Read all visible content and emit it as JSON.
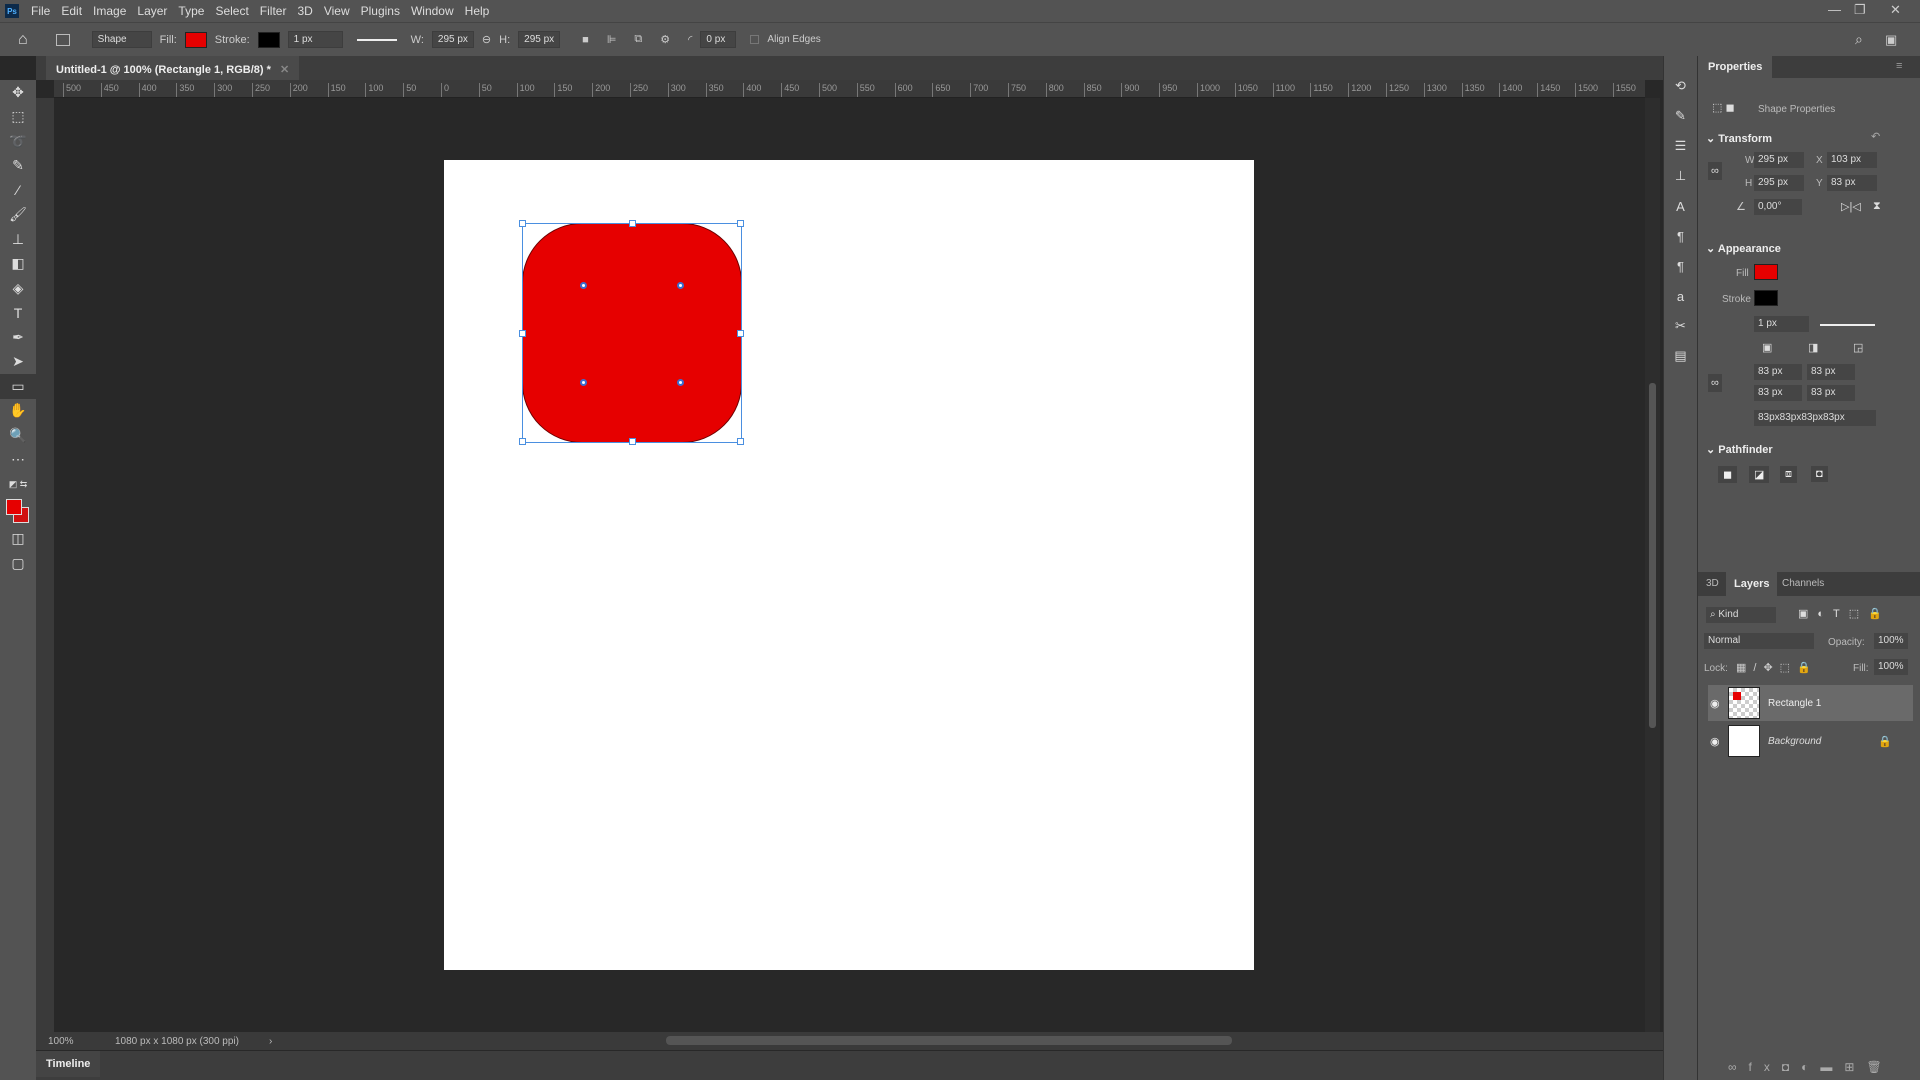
{
  "app": {
    "logo": "Ps",
    "menu": [
      "File",
      "Edit",
      "Image",
      "Layer",
      "Type",
      "Select",
      "Filter",
      "3D",
      "View",
      "Plugins",
      "Window",
      "Help"
    ]
  },
  "options": {
    "mode": "Shape",
    "fill_label": "Fill:",
    "stroke_label": "Stroke:",
    "stroke_width": "1 px",
    "w_label": "W:",
    "w_value": "295 px",
    "h_label": "H:",
    "h_value": "295 px",
    "radius": "0 px",
    "align_edges": "Align Edges",
    "fill_color": "#e60000"
  },
  "document": {
    "tab_title": "Untitled-1 @ 100% (Rectangle 1, RGB/8) *",
    "zoom": "100%",
    "doc_info": "1080 px x 1080 px (300 ppi)"
  },
  "ruler": [
    "500",
    "450",
    "400",
    "350",
    "300",
    "250",
    "200",
    "150",
    "100",
    "50",
    "0",
    "50",
    "100",
    "150",
    "200",
    "250",
    "300",
    "350",
    "400",
    "450",
    "500",
    "550",
    "600",
    "650",
    "700",
    "750",
    "800",
    "850",
    "900",
    "950",
    "1000",
    "1050",
    "1100",
    "1150",
    "1200",
    "1250",
    "1300",
    "1350",
    "1400",
    "1450",
    "1500",
    "1550"
  ],
  "timeline": "Timeline",
  "properties": {
    "title": "Properties",
    "subtitle": "Shape Properties",
    "transform": {
      "title": "Transform",
      "w_label": "W",
      "w": "295 px",
      "h_label": "H",
      "h": "295 px",
      "x_label": "X",
      "x": "103 px",
      "y_label": "Y",
      "y": "83 px",
      "angle": "0,00°"
    },
    "appearance": {
      "title": "Appearance",
      "fill_label": "Fill",
      "stroke_label": "Stroke",
      "stroke_width": "1 px",
      "radii": [
        "83 px",
        "83 px",
        "83 px",
        "83 px"
      ],
      "radii_combined": "83px83px83px83px"
    },
    "pathfinder": {
      "title": "Pathfinder"
    }
  },
  "layers": {
    "tabs": [
      "3D",
      "Layers",
      "Channels"
    ],
    "active_tab": "Layers",
    "filter": "Kind",
    "blend": "Normal",
    "opacity_label": "Opacity:",
    "opacity": "100%",
    "lock_label": "Lock:",
    "fill_label": "Fill:",
    "fill": "100%",
    "items": [
      {
        "name": "Rectangle 1",
        "selected": true
      },
      {
        "name": "Background",
        "locked": true
      }
    ]
  }
}
